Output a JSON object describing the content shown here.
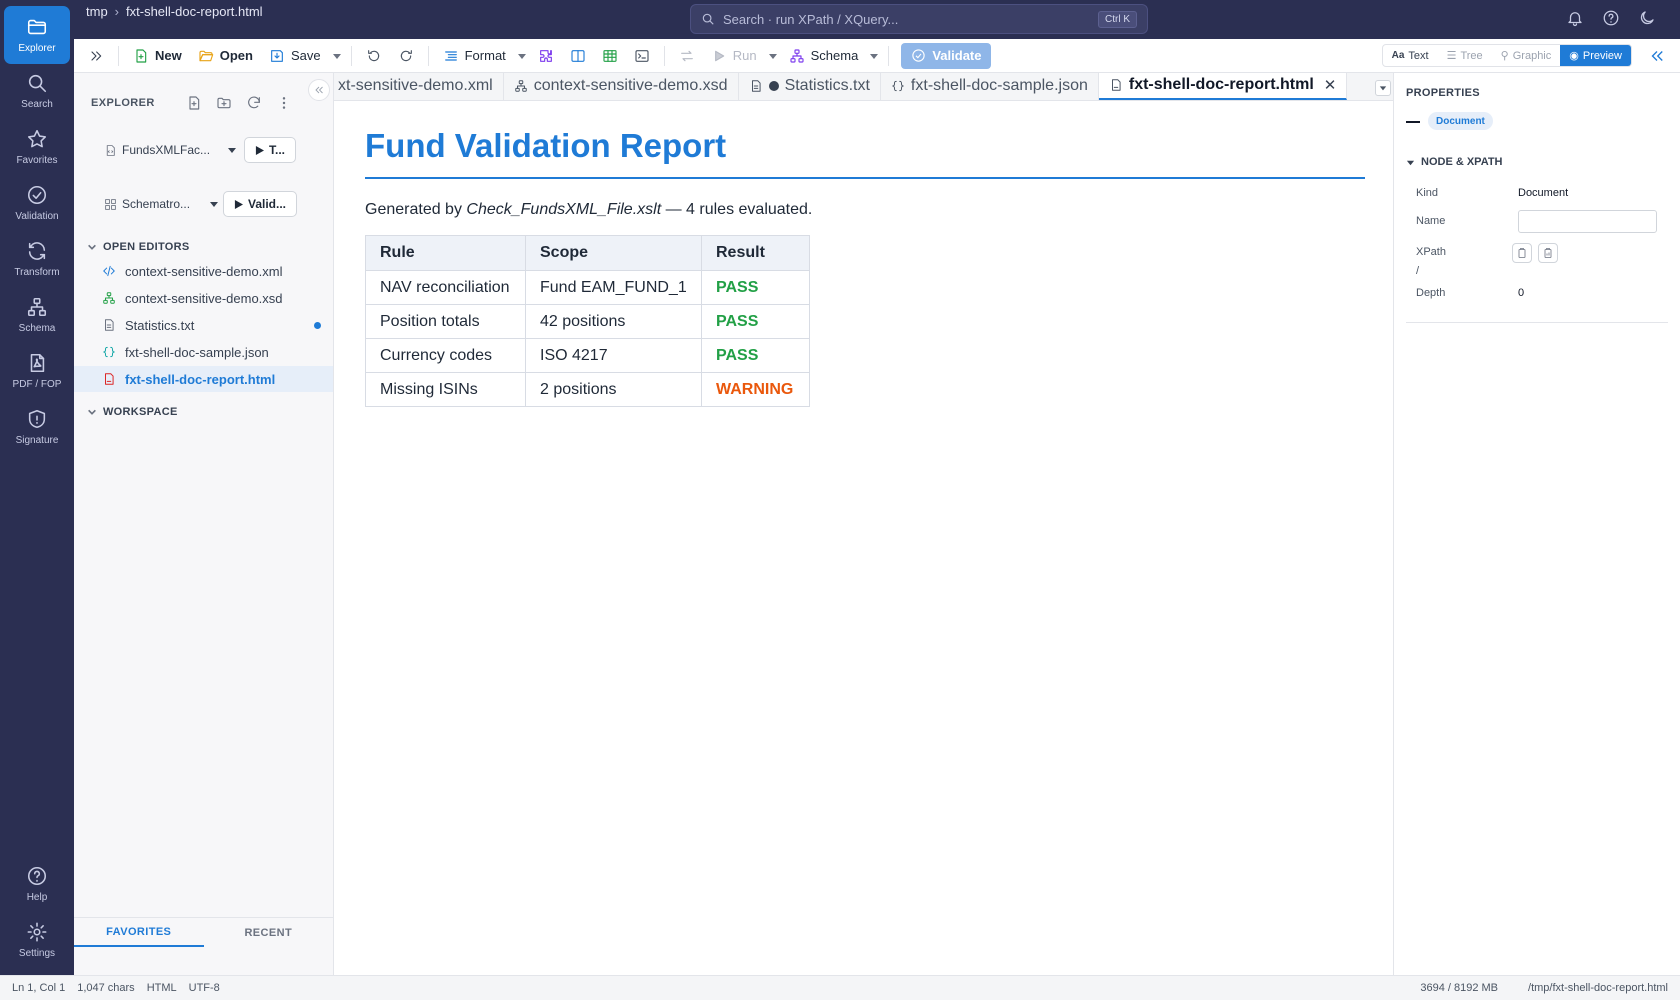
{
  "activity": [
    {
      "label": "Explorer",
      "icon": "folder-icon"
    },
    {
      "label": "Search",
      "icon": "search-icon"
    },
    {
      "label": "Favorites",
      "icon": "star-icon"
    },
    {
      "label": "Validation",
      "icon": "check-circle-icon"
    },
    {
      "label": "Transform",
      "icon": "refresh-icon"
    },
    {
      "label": "Schema",
      "icon": "schema-icon"
    },
    {
      "label": "PDF / FOP",
      "icon": "pdf-icon"
    },
    {
      "label": "Signature",
      "icon": "shield-icon"
    },
    {
      "label": "Help",
      "icon": "help-icon"
    },
    {
      "label": "Settings",
      "icon": "gear-icon"
    }
  ],
  "titlebar": {
    "crumb_root": "tmp",
    "crumb_sep": "›",
    "crumb_file": "fxt-shell-doc-report.html",
    "search_placeholder": "Search · run XPath / XQuery...",
    "search_shortcut": "Ctrl K"
  },
  "toolbar": {
    "new": "New",
    "open": "Open",
    "save": "Save",
    "format": "Format",
    "run": "Run",
    "schema": "Schema",
    "validate": "Validate",
    "view_modes": [
      "Text",
      "Tree",
      "Graphic",
      "Preview"
    ],
    "active_view": "Preview"
  },
  "explorer": {
    "heading": "EXPLORER",
    "transform_picker": "FundsXMLFac...",
    "transform_button": "T...",
    "validation_picker": "Schematro...",
    "validation_button": "Valid...",
    "open_editors_heading": "OPEN EDITORS",
    "files": [
      {
        "name": "context-sensitive-demo.xml",
        "type": "xml"
      },
      {
        "name": "context-sensitive-demo.xsd",
        "type": "xsd"
      },
      {
        "name": "Statistics.txt",
        "type": "txt",
        "modified": true
      },
      {
        "name": "fxt-shell-doc-sample.json",
        "type": "json"
      },
      {
        "name": "fxt-shell-doc-report.html",
        "type": "html",
        "selected": true
      }
    ],
    "workspace_heading": "WORKSPACE",
    "tab_favorites": "FAVORITES",
    "tab_recent": "RECENT"
  },
  "tabs": [
    {
      "label": "xt-sensitive-demo.xml",
      "icon": "code-icon"
    },
    {
      "label": "context-sensitive-demo.xsd",
      "icon": "schema-icon"
    },
    {
      "label": "Statistics.txt",
      "icon": "file-icon",
      "modified": true
    },
    {
      "label": "fxt-shell-doc-sample.json",
      "icon": "braces-icon"
    },
    {
      "label": "fxt-shell-doc-report.html",
      "icon": "html-file-icon",
      "active": true
    }
  ],
  "report": {
    "title": "Fund Validation Report",
    "generated_prefix": "Generated by ",
    "generator": "Check_FundsXML_File.xslt",
    "generated_suffix": " — 4 rules evaluated.",
    "headers": [
      "Rule",
      "Scope",
      "Result"
    ],
    "rows": [
      {
        "rule": "NAV reconciliation",
        "scope": "Fund EAM_FUND_1",
        "result": "PASS",
        "status": "pass"
      },
      {
        "rule": "Position totals",
        "scope": "42 positions",
        "result": "PASS",
        "status": "pass"
      },
      {
        "rule": "Currency codes",
        "scope": "ISO 4217",
        "result": "PASS",
        "status": "pass"
      },
      {
        "rule": "Missing ISINs",
        "scope": "2 positions",
        "result": "WARNING",
        "status": "warning"
      }
    ]
  },
  "properties": {
    "heading": "PROPERTIES",
    "badge": "Document",
    "section": "NODE & XPATH",
    "kind_label": "Kind",
    "kind_value": "Document",
    "name_label": "Name",
    "name_value": "",
    "xpath_label": "XPath",
    "xpath_value": "/",
    "depth_label": "Depth",
    "depth_value": "0"
  },
  "status": {
    "position": "Ln 1, Col 1",
    "chars": "1,047 chars",
    "language": "HTML",
    "encoding": "UTF-8",
    "memory": "3694 / 8192 MB",
    "path": "/tmp/fxt-shell-doc-report.html"
  },
  "colors": {
    "accent": "#1f7bd6",
    "sidebar": "#2b2f52",
    "pass": "#22a046",
    "warning": "#ea580c"
  }
}
